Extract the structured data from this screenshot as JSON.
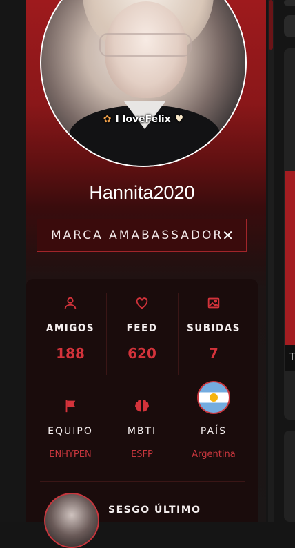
{
  "profile": {
    "username": "Hannita2020",
    "avatar_caption": "I loveFelix",
    "badge_label": "MARCA AMABASSADOR",
    "badge_close": "✕"
  },
  "stats": [
    {
      "icon": "user-icon",
      "label": "AMIGOS",
      "value": "188"
    },
    {
      "icon": "heart-icon",
      "label": "FEED",
      "value": "620"
    },
    {
      "icon": "image-icon",
      "label": "SUBIDAS",
      "value": "7"
    }
  ],
  "info": [
    {
      "icon": "flag-icon",
      "label": "EQUIPO",
      "value": "ENHYPEN"
    },
    {
      "icon": "brain-icon",
      "label": "MBTI",
      "value": "ESFP"
    },
    {
      "icon": "argentina-flag-icon",
      "label": "PAÍS",
      "value": "Argentina"
    }
  ],
  "recent": {
    "title": "SESGO ÚLTIMO"
  },
  "right_panel": {
    "letter": "T"
  },
  "colors": {
    "accent": "#d4333b",
    "brand_red": "#a31d21"
  }
}
